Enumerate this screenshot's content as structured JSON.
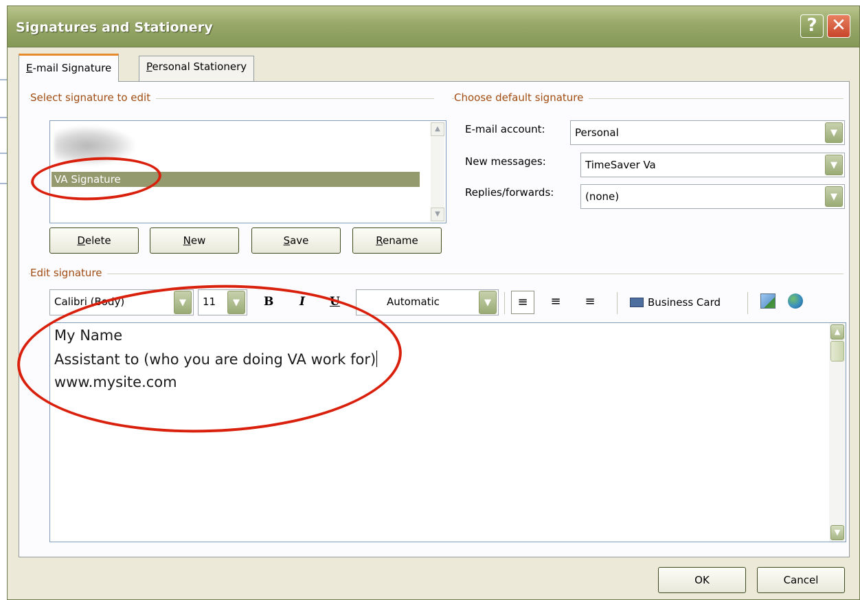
{
  "dialog": {
    "title": "Signatures and Stationery",
    "help_glyph": "?",
    "close_glyph": "✕"
  },
  "tabs": [
    {
      "label_prefix": "",
      "label_access": "E",
      "label_rest": "-mail Signature"
    },
    {
      "label_prefix": "",
      "label_access": "P",
      "label_rest": "ersonal Stationery"
    }
  ],
  "select_signature": {
    "group_label": "Select signature to edit",
    "items": [
      "VA Signature"
    ],
    "selected": "VA Signature"
  },
  "signature_buttons": [
    {
      "access": "D",
      "rest": "elete"
    },
    {
      "access": "N",
      "rest": "ew"
    },
    {
      "access": "S",
      "rest": "ave"
    },
    {
      "access": "R",
      "rest": "ename"
    }
  ],
  "default_signature": {
    "group_label": "Choose default signature",
    "email_account_label": "E-mail account:",
    "email_account_value": "Personal",
    "new_messages_label": "New messages:",
    "new_messages_value": "TimeSaver Va",
    "replies_label": "Replies/forwards:",
    "replies_value": "(none)"
  },
  "edit_signature": {
    "group_label": "Edit signature",
    "font": "Calibri (Body)",
    "size": "11",
    "bold": "B",
    "italic": "I",
    "underline": "U",
    "color": "Automatic",
    "business_card": "Business Card",
    "lines": [
      "My Name",
      "Assistant to (who you are doing VA work for)",
      "www.mysite.com"
    ]
  },
  "footer": {
    "ok": "OK",
    "cancel": "Cancel"
  },
  "colors": {
    "titlebar": "#98a868",
    "group_label": "#a04c12",
    "selection": "#949a6e",
    "annotation": "#d9200c",
    "active_tab_accent": "#e68b2c"
  }
}
